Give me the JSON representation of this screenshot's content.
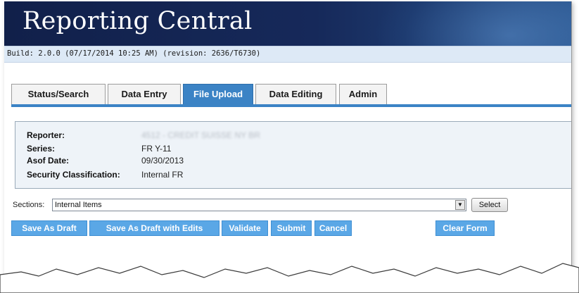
{
  "app": {
    "title": "Reporting Central",
    "build": "Build: 2.0.0 (07/17/2014 10:25 AM) (revision: 2636/T6730)"
  },
  "tabs": [
    {
      "label": "Status/Search",
      "active": false
    },
    {
      "label": "Data Entry",
      "active": false
    },
    {
      "label": "File Upload",
      "active": true
    },
    {
      "label": "Data Editing",
      "active": false
    },
    {
      "label": "Admin",
      "active": false
    }
  ],
  "info": {
    "reporter_label": "Reporter:",
    "reporter_value": "4512 - CREDIT SUISSE NY BR",
    "series_label": "Series:",
    "series_value": "FR Y-11",
    "asof_label": "Asof Date:",
    "asof_value": "09/30/2013",
    "security_label": "Security Classification:",
    "security_value": "Internal FR"
  },
  "sections": {
    "label": "Sections:",
    "selected": "Internal Items",
    "select_button": "Select"
  },
  "actions": {
    "save_draft": "Save As Draft",
    "save_draft_edits": "Save As Draft with Edits",
    "validate": "Validate",
    "submit": "Submit",
    "cancel": "Cancel",
    "clear_form": "Clear Form"
  },
  "colors": {
    "banner": "#16295a",
    "accent": "#3b83c5",
    "action_button": "#5aa7e6",
    "build_bar": "#dde9f6"
  }
}
